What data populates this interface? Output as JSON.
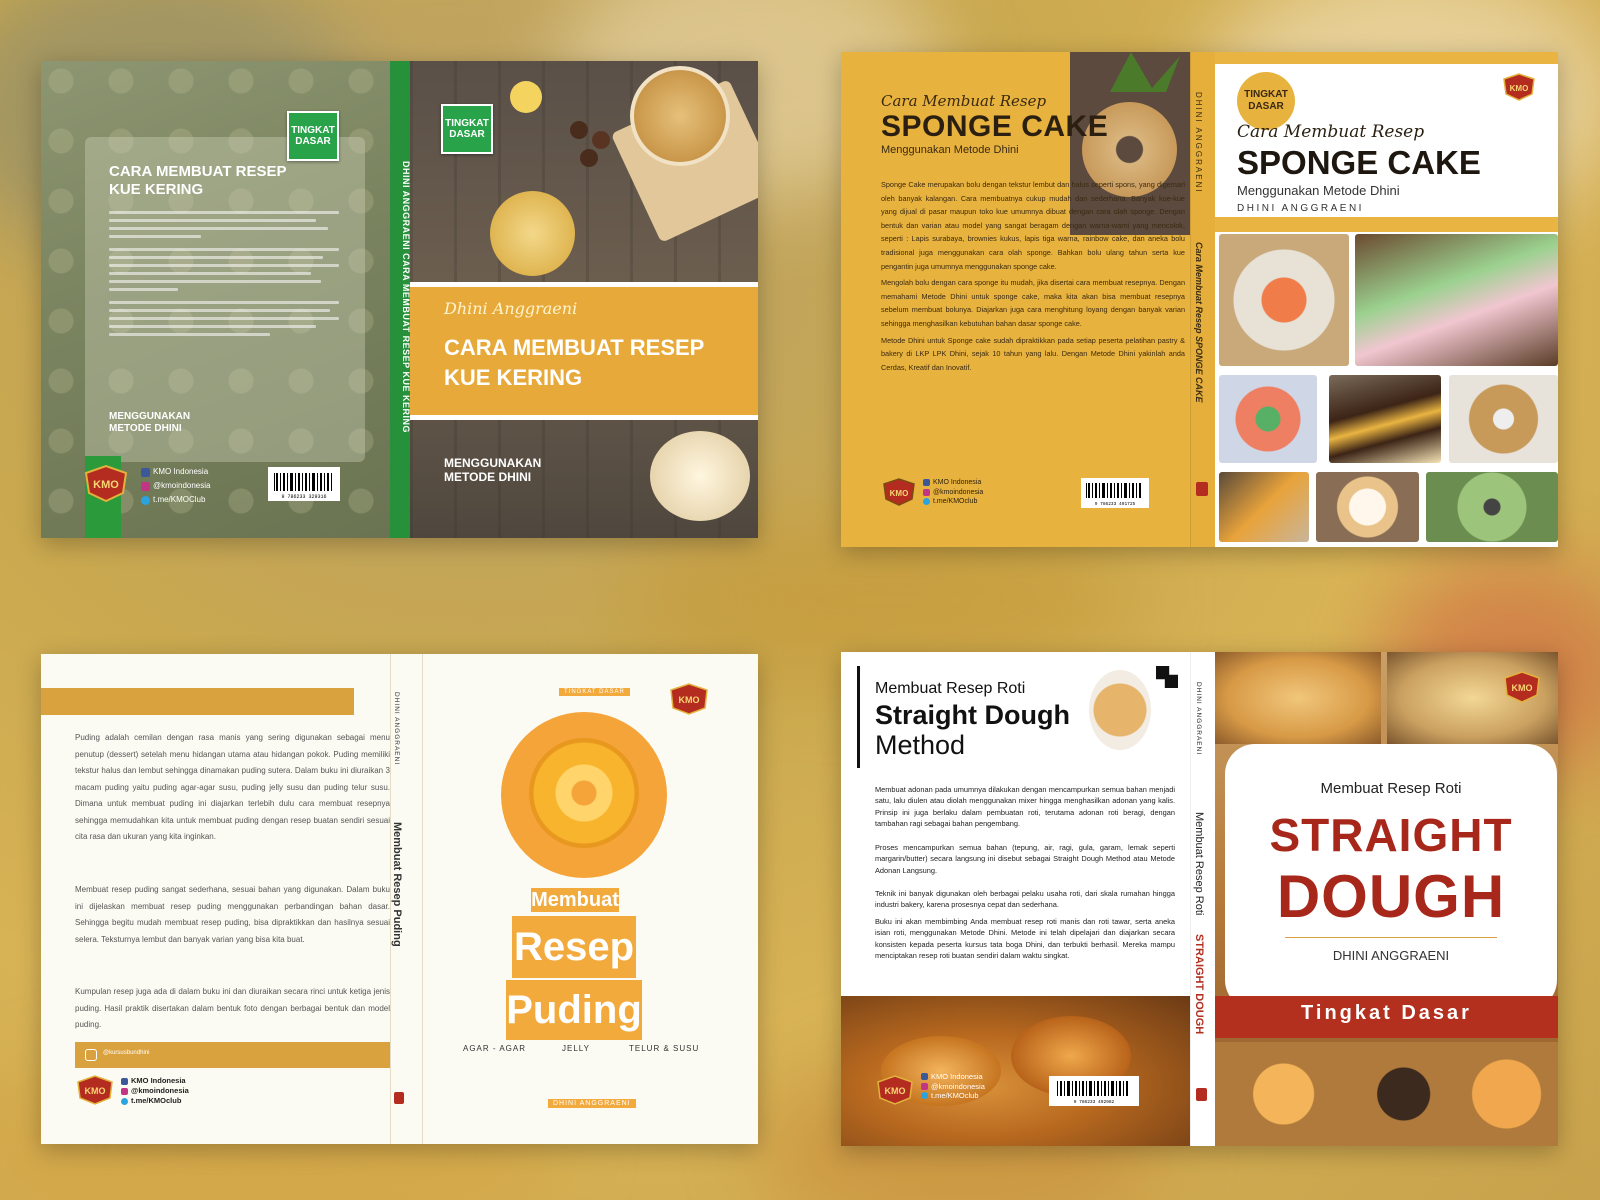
{
  "covers": {
    "kue_kering": {
      "back_badge": "TINGKAT DASAR",
      "back_title": "CARA MEMBUAT RESEP KUE KERING",
      "back_subtitle": "MENGGUNAKAN METODE DHINI",
      "social_facebook": "KMO Indonesia",
      "social_instagram": "@kmoindonesia",
      "social_telegram": "t.me/KMOClub",
      "barcode_number": "9 786233 329316",
      "spine_text": "DHINI ANGGRAENI   CARA MEMBUAT RESEP KUE KERING",
      "front_badge": "TINGKAT DASAR",
      "front_author": "Dhini Anggraeni",
      "front_title": "CARA MEMBUAT RESEP KUE KERING",
      "front_subtitle": "MENGGUNAKAN METODE DHINI",
      "logo": "KMO"
    },
    "sponge_cake": {
      "back_script": "Cara Membuat Resep",
      "back_title": "SPONGE CAKE",
      "back_subtitle": "Menggunakan Metode Dhini",
      "para1": "Sponge Cake merupakan bolu dengan tekstur lembut dan halus seperti spons, yang digemari oleh banyak kalangan. Cara membuatnya cukup mudah dan sederhana. Banyak kue-kue yang dijual di pasar maupun toko kue umumnya dibuat dengan cara olah sponge. Dengan bentuk dan varian atau model yang sangat beragam dengan warna-warni yang mencolok, seperti : Lapis surabaya, brownies kukus, lapis tiga warna, rainbow cake, dan aneka bolu tradisional juga menggunakan cara olah sponge. Bahkan bolu ulang tahun serta kue pengantin juga umumnya menggunakan sponge cake.",
      "para2": "Mengolah bolu dengan cara sponge itu mudah, jika disertai cara membuat resepnya. Dengan memahami Metode Dhini untuk sponge cake, maka kita akan bisa membuat resepnya sebelum membuat bolunya. Diajarkan juga cara menghitung loyang dengan banyak varian sehingga menghasilkan kebutuhan bahan dasar sponge cake.",
      "para3": "Metode Dhini untuk Sponge cake sudah dipraktikkan pada setiap peserta pelatihan pastry & bakery di LKP LPK Dhini, sejak 10 tahun yang lalu. Dengan Metode Dhini yakinlah anda Cerdas, Kreatif dan Inovatif.",
      "social_facebook": "KMO Indonesia",
      "social_instagram": "@kmoindonesia",
      "social_telegram": "t.me/KMOclub",
      "barcode_number": "9 786233 491725",
      "spine_author": "DHINI ANGGRAENI",
      "spine_title": "Cara Membuat Resep SPONGE CAKE",
      "front_badge": "TINGKAT DASAR",
      "front_script": "Cara Membuat Resep",
      "front_title": "SPONGE CAKE",
      "front_subtitle": "Menggunakan Metode Dhini",
      "front_author": "DHINI ANGGRAENI",
      "logo": "KMO"
    },
    "puding": {
      "para1": "Puding adalah cemilan dengan rasa manis yang sering digunakan sebagai menu penutup (dessert) setelah menu hidangan utama atau hidangan pokok. Puding memiliki tekstur halus dan lembut sehingga dinamakan puding sutera. Dalam buku ini diuraikan 3 macam puding yaitu puding agar-agar susu, puding jelly susu dan puding telur susu. Dimana untuk membuat puding ini diajarkan terlebih dulu cara membuat resepnya sehingga memudahkan kita untuk membuat puding dengan resep buatan sendiri sesuai cita rasa dan ukuran yang kita inginkan.",
      "para2": "Membuat resep puding sangat sederhana, sesuai bahan yang digunakan. Dalam buku ini dijelaskan membuat resep puding menggunakan perbandingan bahan dasar. Sehingga begitu mudah membuat resep puding, bisa dipraktikkan dan hasilnya sesuai selera. Teksturnya lembut dan banyak varian yang bisa kita buat.",
      "para3": "Kumpulan resep juga ada di dalam buku ini dan diuraikan secara rinci untuk ketiga jenis puding. Hasil praktik disertakan dalam bentuk foto dengan berbagai bentuk dan model puding.",
      "instagram_bar": "@kursusbundhini",
      "social_facebook": "KMO Indonesia",
      "social_instagram": "@kmoindonesia",
      "social_telegram": "t.me/KMOclub",
      "spine_author": "DHINI ANGGRAENI",
      "spine_title": "Membuat Resep Puding",
      "front_badge": "TINGKAT DASAR",
      "word1": "Membuat",
      "word2": "Resep",
      "word3": "Puding",
      "variant1": "AGAR - AGAR",
      "variant2": "JELLY",
      "variant3": "TELUR & SUSU",
      "front_author": "DHINI ANGGRAENI",
      "logo": "KMO"
    },
    "straight_dough": {
      "back_line1": "Membuat Resep Roti",
      "back_line2": "Straight Dough",
      "back_line3": "Method",
      "para1": "Membuat adonan pada umumnya dilakukan dengan mencampurkan semua bahan menjadi satu, lalu diulen atau diolah menggunakan mixer hingga menghasilkan adonan yang kalis. Prinsip ini juga berlaku dalam pembuatan roti, terutama adonan roti beragi, dengan tambahan ragi sebagai bahan pengembang.",
      "para2": "Proses mencampurkan semua bahan (tepung, air, ragi, gula, garam, lemak seperti margarin/butter) secara langsung ini disebut sebagai Straight Dough Method atau Metode Adonan Langsung.",
      "para3": "Teknik ini banyak digunakan oleh berbagai pelaku usaha roti, dari skala rumahan hingga industri bakery, karena prosesnya cepat dan sederhana.",
      "para4": "Buku ini akan membimbing Anda membuat resep roti manis dan roti tawar, serta aneka isian roti, menggunakan Metode Dhini. Metode ini telah dipelajari dan diajarkan secara konsisten kepada peserta kursus tata boga Dhini, dan terbukti berhasil. Mereka mampu menciptakan resep roti buatan sendiri dalam waktu singkat.",
      "social_facebook": "KMO Indonesia",
      "social_instagram": "@kmoindonesia",
      "social_telegram": "t.me/KMOclub",
      "barcode_number": "9 786233 492982",
      "spine_author": "DHINI ANGGRAENI",
      "spine_title": "Membuat Resep Roti",
      "spine_title_red": "STRAIGHT DOUGH",
      "front_line1": "Membuat Resep Roti",
      "front_title1": "STRAIGHT",
      "front_title2": "DOUGH",
      "front_author": "DHINI ANGGRAENI",
      "front_level": "Tingkat Dasar",
      "logo": "KMO"
    }
  }
}
